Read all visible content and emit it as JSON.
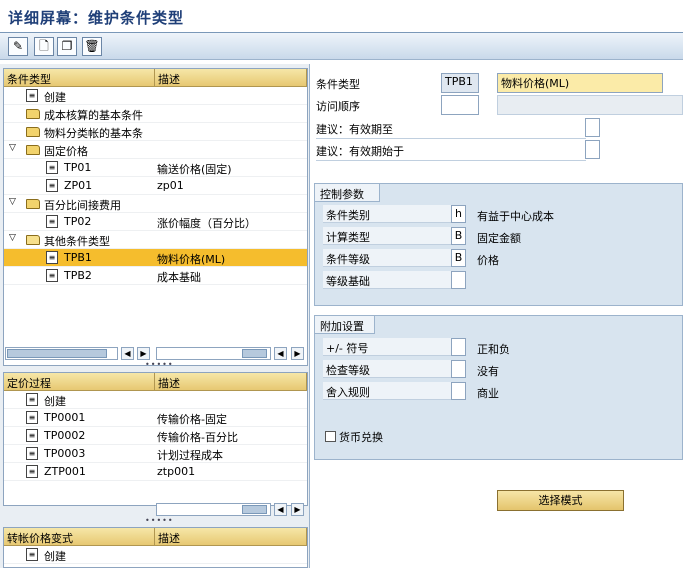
{
  "title": "详细屏幕：维护条件类型",
  "tree1": {
    "col1": "条件类型",
    "col2": "描述",
    "rows": [
      {
        "label": "创建",
        "desc": "",
        "icon": "doc",
        "indent": 1,
        "arrow": ""
      },
      {
        "label": "成本核算的基本条件",
        "desc": "",
        "icon": "folder",
        "indent": 1,
        "arrow": ""
      },
      {
        "label": "物料分类帐的基本条",
        "desc": "",
        "icon": "folder",
        "indent": 1,
        "arrow": ""
      },
      {
        "label": "固定价格",
        "desc": "",
        "icon": "folder",
        "indent": 1,
        "arrow": "▽"
      },
      {
        "label": "TP01",
        "desc": "输送价格(固定)",
        "icon": "doc",
        "indent": 3,
        "arrow": ""
      },
      {
        "label": "ZP01",
        "desc": "zp01",
        "icon": "doc",
        "indent": 3,
        "arrow": ""
      },
      {
        "label": "百分比间接费用",
        "desc": "",
        "icon": "folder",
        "indent": 1,
        "arrow": "▽"
      },
      {
        "label": "TP02",
        "desc": "涨价幅度（百分比）",
        "icon": "doc",
        "indent": 3,
        "arrow": ""
      },
      {
        "label": "其他条件类型",
        "desc": "",
        "icon": "folderopen",
        "indent": 1,
        "arrow": "▽"
      },
      {
        "label": "TPB1",
        "desc": "物料价格(ML)",
        "icon": "doc",
        "indent": 3,
        "arrow": "",
        "selected": true
      },
      {
        "label": "TPB2",
        "desc": "成本基础",
        "icon": "doc",
        "indent": 3,
        "arrow": ""
      }
    ]
  },
  "tree2": {
    "col1": "定价过程",
    "col2": "描述",
    "rows": [
      {
        "label": "创建",
        "desc": ""
      },
      {
        "label": "TP0001",
        "desc": "传输价格-固定"
      },
      {
        "label": "TP0002",
        "desc": "传输价格-百分比"
      },
      {
        "label": "TP0003",
        "desc": "计划过程成本"
      },
      {
        "label": "ZTP001",
        "desc": "ztp001"
      }
    ]
  },
  "tree3": {
    "col1": "转帐价格变式",
    "col2": "描述",
    "rows": [
      {
        "label": "创建",
        "desc": ""
      }
    ]
  },
  "form": {
    "cond_type_label": "条件类型",
    "cond_type_value": "TPB1",
    "cond_type_desc": "物料价格(ML)",
    "access_seq_label": "访问顺序",
    "valid_to_label": "建议：有效期至",
    "valid_from_label": "建议：有效期始于"
  },
  "control": {
    "title": "控制参数",
    "rows": [
      {
        "label": "条件类别",
        "value": "h",
        "desc": "有益于中心成本"
      },
      {
        "label": "计算类型",
        "value": "B",
        "desc": "固定金额"
      },
      {
        "label": "条件等级",
        "value": "B",
        "desc": "价格"
      },
      {
        "label": "等级基础",
        "value": "",
        "desc": ""
      }
    ]
  },
  "additional": {
    "title": "附加设置",
    "rows": [
      {
        "label": "+/- 符号",
        "value": "",
        "desc": "正和负"
      },
      {
        "label": "检查等级",
        "value": "",
        "desc": "没有"
      },
      {
        "label": "舍入规则",
        "value": "",
        "desc": "商业"
      }
    ],
    "currency_conv": "货币兑换"
  },
  "select_mode_button": "选择模式"
}
